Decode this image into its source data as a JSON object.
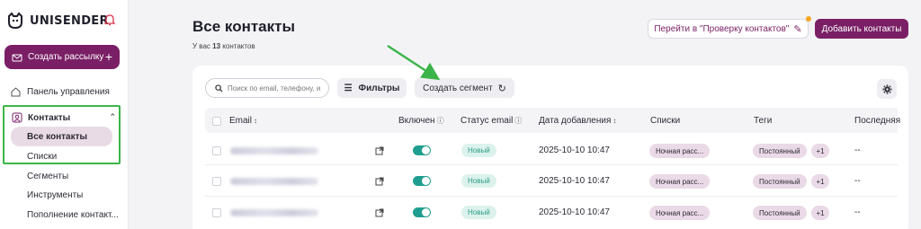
{
  "app": {
    "logo_text": "UNISENDER"
  },
  "sidebar": {
    "create_label": "Создать рассылку",
    "create_plus": "+",
    "items": [
      {
        "label": "Панель управления"
      }
    ],
    "contacts": {
      "label": "Контакты",
      "sub": [
        "Все контакты",
        "Списки",
        "Сегменты",
        "Инструменты",
        "Пополнение контакт..."
      ]
    }
  },
  "header": {
    "title": "Все контакты",
    "subtitle_prefix": "У вас",
    "count": "13",
    "subtitle_suffix": "контактов",
    "check_button": "Перейти в \"Проверку контактов\"",
    "add_button": "Добавить контакты"
  },
  "toolbar": {
    "search_placeholder": "Поиск по email, телефону, и",
    "filters_label": "Фильтры",
    "segment_label": "Создать сегмент"
  },
  "table": {
    "columns": {
      "email": "Email",
      "enabled": "Включен",
      "status": "Статус email",
      "date": "Дата добавления",
      "lists": "Списки",
      "tags": "Теги",
      "last": "Последняя"
    },
    "rows": [
      {
        "status": "Новый",
        "date": "2025-10-10 10:47",
        "list": "Ночная расс...",
        "tag": "Постоянный",
        "tag_more": "+1",
        "last": "--",
        "enabled": true
      },
      {
        "status": "Новый",
        "date": "2025-10-10 10:47",
        "list": "Ночная расс...",
        "tag": "Постоянный",
        "tag_more": "+1",
        "last": "--",
        "enabled": true
      },
      {
        "status": "Новый",
        "date": "2025-10-10 10:47",
        "list": "Ночная расс...",
        "tag": "Постоянный",
        "tag_more": "+1",
        "last": "--",
        "enabled": true
      }
    ]
  },
  "colors": {
    "brand": "#7a1f66",
    "toggle_on": "#1f9e8f",
    "highlight": "#3bb54a"
  }
}
